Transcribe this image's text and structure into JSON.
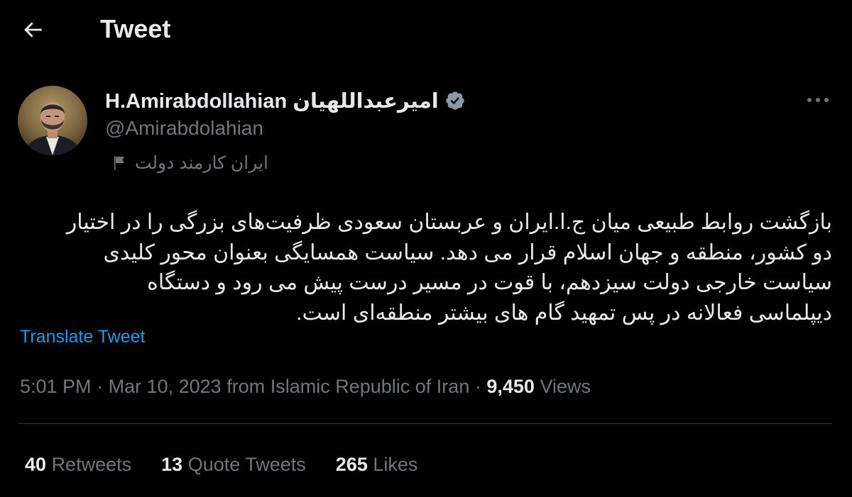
{
  "header": {
    "title": "Tweet",
    "back_icon": "arrow-left-icon"
  },
  "author": {
    "display_name": "H.Amirabdollahian امیرعبداللهیان",
    "handle": "@Amirabdolahian",
    "verified_icon": "verified-badge-icon",
    "verified_color": "#8b98a5",
    "label_text": "ایران کارمند دولت",
    "label_icon": "flag-icon"
  },
  "more_icon": "more-dots-icon",
  "tweet": {
    "text": "بازگشت روابط طبیعی میان ج.ا.ایران و عربستان سعودی ظرفیت‌های بزرگی را در اختیار\nدو کشور، منطقه و جهان اسلام قرار می دهد. سیاست همسایگی بعنوان محور کلیدی\nسیاست خارجی دولت سیزدهم، با قوت در مسیر درست پیش می رود و دستگاه\nدیپلماسی فعالانه در پس تمهید گام های بیشتر منطقه‌ای است.",
    "translate_label": "Translate Tweet",
    "translate_color": "#1d9bf0"
  },
  "meta": {
    "time": "5:01 PM",
    "separator": "·",
    "date": "Mar 10, 2023",
    "source": "from Islamic Republic of Iran",
    "views_count": "9,450",
    "views_label": "Views"
  },
  "stats": [
    {
      "count": "40",
      "label": "Retweets"
    },
    {
      "count": "13",
      "label": "Quote Tweets"
    },
    {
      "count": "265",
      "label": "Likes"
    }
  ],
  "colors": {
    "background": "#000000",
    "primary_text": "#e7e9ea",
    "secondary_text": "#71767b",
    "divider": "#2f3336"
  }
}
